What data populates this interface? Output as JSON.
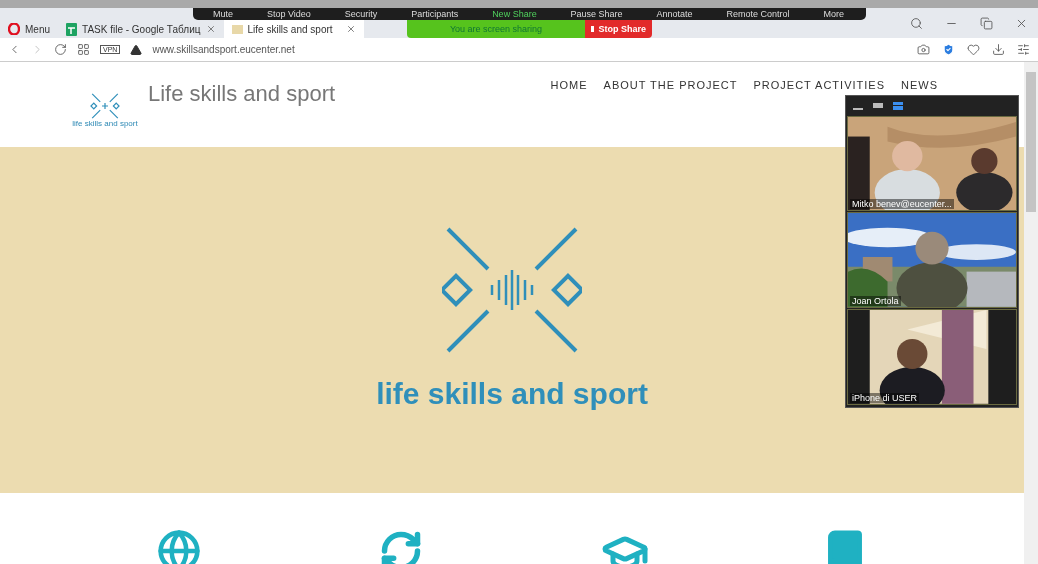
{
  "browser": {
    "tabs": [
      {
        "label": "Menu",
        "kind": "menu",
        "selected": false
      },
      {
        "label": "TASK file - Google Таблиц",
        "kind": "sheet",
        "selected": false
      },
      {
        "label": "Life skills and sport",
        "kind": "page",
        "selected": true
      }
    ],
    "vpn_badge": "VPN",
    "address": "www.skillsandsport.eucenter.net"
  },
  "zoom_toolbar": [
    {
      "label": "Mute",
      "highlighted": false
    },
    {
      "label": "Stop Video",
      "highlighted": false
    },
    {
      "label": "Security",
      "highlighted": false
    },
    {
      "label": "Participants",
      "highlighted": false
    },
    {
      "label": "New Share",
      "highlighted": true
    },
    {
      "label": "Pause Share",
      "highlighted": false
    },
    {
      "label": "Annotate",
      "highlighted": false
    },
    {
      "label": "Remote Control",
      "highlighted": false
    },
    {
      "label": "More",
      "highlighted": false
    }
  ],
  "share_banner": {
    "text": "You are screen sharing",
    "button": "Stop Share"
  },
  "site": {
    "logo_caption": "life skills and sport",
    "title": "Life skills and sport",
    "nav": [
      "HOME",
      "ABOUT THE PROJECT",
      "PROJECT ACTIVITIES",
      "NEWS"
    ],
    "hero_title": "life skills and sport"
  },
  "video_panel": {
    "view_modes": [
      {
        "selected": false
      },
      {
        "selected": false
      },
      {
        "selected": true
      }
    ],
    "participants": [
      {
        "name": "Mitko benev@eucenter...",
        "kind": "picture"
      },
      {
        "name": "Joan Ortola",
        "kind": "picture"
      },
      {
        "name": "iPhone di USER",
        "kind": "picture"
      }
    ]
  }
}
